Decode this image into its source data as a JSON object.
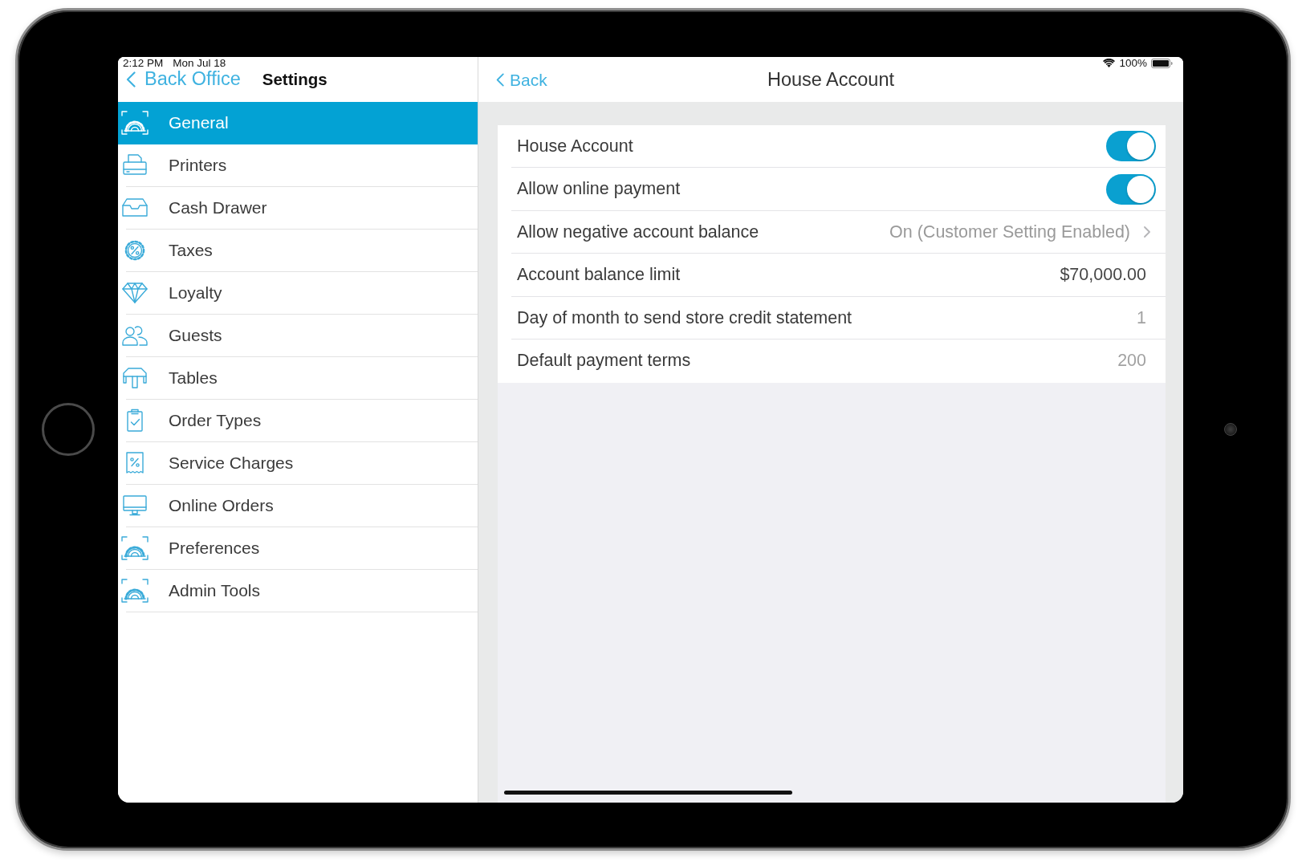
{
  "status_bar": {
    "time": "2:12 PM",
    "date": "Mon Jul 18",
    "battery": "100%"
  },
  "sidebar": {
    "back_label": "Back Office",
    "title": "Settings",
    "items": [
      {
        "label": "General",
        "selected": true
      },
      {
        "label": "Printers",
        "selected": false
      },
      {
        "label": "Cash Drawer",
        "selected": false
      },
      {
        "label": "Taxes",
        "selected": false
      },
      {
        "label": "Loyalty",
        "selected": false
      },
      {
        "label": "Guests",
        "selected": false
      },
      {
        "label": "Tables",
        "selected": false
      },
      {
        "label": "Order Types",
        "selected": false
      },
      {
        "label": "Service Charges",
        "selected": false
      },
      {
        "label": "Online Orders",
        "selected": false
      },
      {
        "label": "Preferences",
        "selected": false
      },
      {
        "label": "Admin Tools",
        "selected": false
      }
    ]
  },
  "detail": {
    "back_label": "Back",
    "title": "House Account",
    "rows": [
      {
        "kind": "toggle",
        "label": "House Account",
        "on": true
      },
      {
        "kind": "toggle",
        "label": "Allow online payment",
        "on": true
      },
      {
        "kind": "disclosure",
        "label": "Allow negative account balance",
        "value": "On (Customer Setting Enabled)"
      },
      {
        "kind": "value",
        "label": "Account balance limit",
        "value": "$70,000.00",
        "dimmed": false
      },
      {
        "kind": "value",
        "label": "Day of month to send store credit statement",
        "value": "1",
        "dimmed": true
      },
      {
        "kind": "value",
        "label": "Default payment terms",
        "value": "200",
        "dimmed": true
      }
    ]
  }
}
